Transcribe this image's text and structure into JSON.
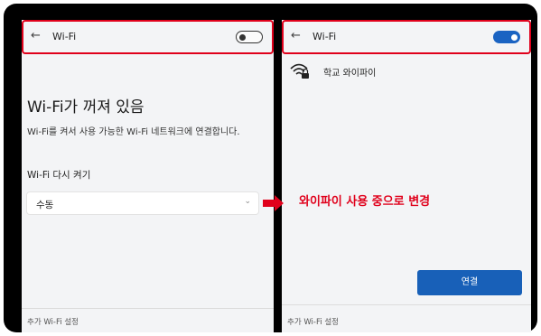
{
  "left_panel": {
    "back_glyph": "←",
    "header_title": "Wi-Fi",
    "toggle_state": "off",
    "main_title": "Wi-Fi가 꺼져 있음",
    "description": "Wi-Fi를 켜서 사용 가능한 Wi-Fi 네트워크에 연결합니다.",
    "turn_back_on_label": "Wi-Fi 다시 켜기",
    "dropdown_value": "수동",
    "footer_link": "추가 Wi-Fi 설정"
  },
  "right_panel": {
    "back_glyph": "←",
    "header_title": "Wi-Fi",
    "toggle_state": "on",
    "network_icon": "wifi-secured-icon",
    "network_name": "학교 와이파이",
    "connect_button": "연결",
    "footer_link": "추가 Wi-Fi 설정"
  },
  "annotation": {
    "arrow_icon": "right-arrow-icon",
    "callout_text": "와이파이 사용 중으로 변경"
  },
  "colors": {
    "highlight_red": "#e0001b",
    "toggle_on_blue": "#1a63c2",
    "button_blue": "#1860b8",
    "frame_black": "#000000"
  }
}
